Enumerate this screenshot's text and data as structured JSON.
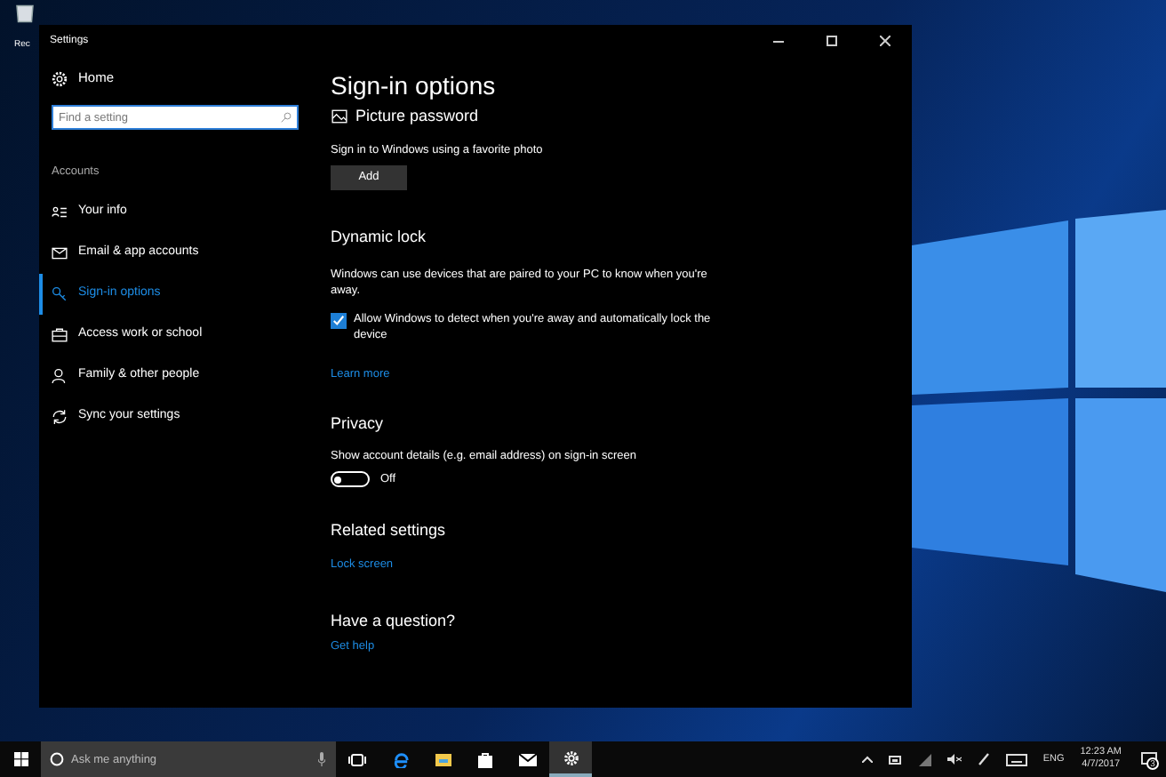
{
  "desktop": {
    "icon_label": "Rec"
  },
  "window": {
    "title": "Settings"
  },
  "sidebar": {
    "home": "Home",
    "search": {
      "placeholder": "Find a setting"
    },
    "section": "Accounts",
    "items": [
      {
        "label": "Your info",
        "selected": false
      },
      {
        "label": "Email & app accounts",
        "selected": false
      },
      {
        "label": "Sign-in options",
        "selected": true
      },
      {
        "label": "Access work or school",
        "selected": false
      },
      {
        "label": "Family & other people",
        "selected": false
      },
      {
        "label": "Sync your settings",
        "selected": false
      }
    ]
  },
  "content": {
    "title": "Sign-in options",
    "picture_password": {
      "heading": "Picture password",
      "description": "Sign in to Windows using a favorite photo",
      "button": "Add"
    },
    "dynamic_lock": {
      "heading": "Dynamic lock",
      "description": "Windows can use devices that are paired to your PC to know when you're away.",
      "checkbox": {
        "label": "Allow Windows to detect when you're away and automatically lock the device",
        "checked": true
      },
      "link": "Learn more"
    },
    "privacy": {
      "heading": "Privacy",
      "description": "Show account details (e.g. email address) on sign-in screen",
      "toggle": {
        "on": false,
        "label": "Off"
      }
    },
    "related": {
      "heading": "Related settings",
      "link": "Lock screen"
    },
    "question": {
      "heading": "Have a question?",
      "link": "Get help"
    }
  },
  "taskbar": {
    "search": {
      "placeholder": "Ask me anything"
    },
    "language": "ENG",
    "time": "12:23 AM",
    "date": "4/7/2017",
    "notifications": "3"
  }
}
